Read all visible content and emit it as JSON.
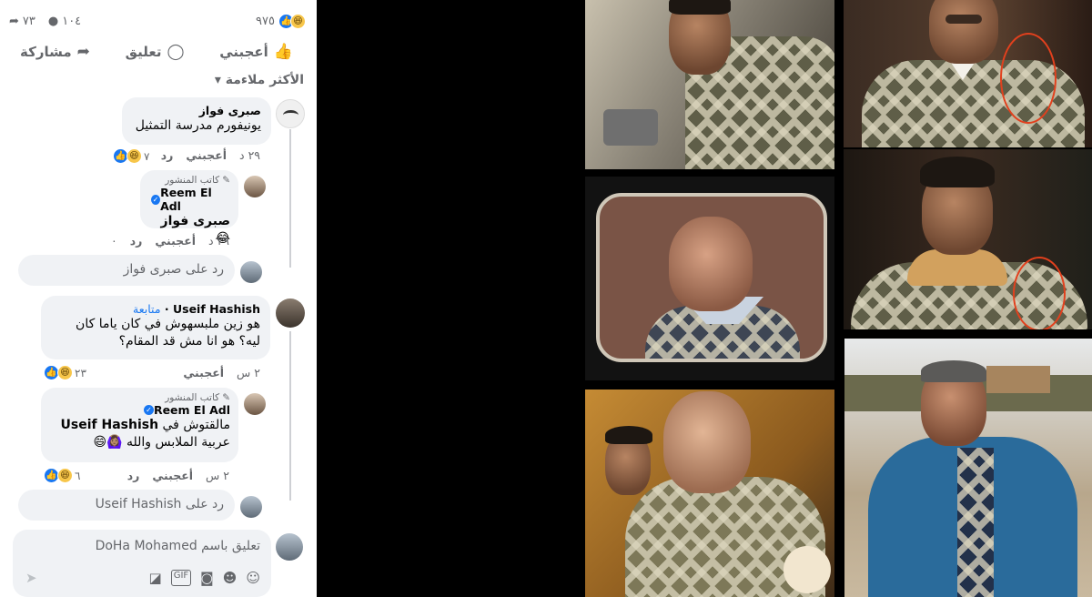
{
  "post": {
    "reactions_count": "٩٧٥",
    "comments_count": "١٠٤",
    "shares_count": "٧٣"
  },
  "actions": {
    "like": "أعجبني",
    "comment": "تعليق",
    "share": "مشاركة"
  },
  "sort_label": "الأكثر ملاءمة",
  "comments": [
    {
      "name": "صبرى فواز",
      "text": "يونيفورم مدرسة التمثيل",
      "time": "٢٩ د",
      "like": "أعجبني",
      "reply": "رد",
      "reaction_count": "٧",
      "replies": [
        {
          "author_tag": "كاتب المنشور",
          "name": "Reem El Adl",
          "text": "صبرى فواز 😂",
          "time": "٢٩ د",
          "like": "أعجبني",
          "reply": "رد",
          "reaction_count": "٠"
        }
      ],
      "reply_placeholder": "رد على صبرى فواز"
    },
    {
      "name": "Useif Hashish",
      "follow": "متابعة",
      "text": "هو زين ملبسهوش في كان ياما كان ليه؟ هو انا مش قد المقام؟",
      "time": "٢ س",
      "like": "أعجبني",
      "reaction_count": "٢٣",
      "replies": [
        {
          "author_tag": "كاتب المنشور",
          "name": "Reem El Adl",
          "mention": "Useif Hashish",
          "text_before": "مالقتوش في",
          "text": "عربية الملابس والله 🙆🏽‍♀️😄",
          "time": "٢ س",
          "like": "أعجبني",
          "reply": "رد",
          "reaction_count": "٦"
        }
      ],
      "reply_placeholder": "رد على Useif Hashish"
    }
  ],
  "composer_placeholder": "تعليق باسم DoHa Mohamed",
  "icons": [
    "like-outline-icon",
    "comment-icon",
    "share-icon",
    "sticker-icon",
    "gif-icon",
    "camera-icon",
    "emoji-icon",
    "avatar-sticker-icon",
    "send-icon"
  ]
}
